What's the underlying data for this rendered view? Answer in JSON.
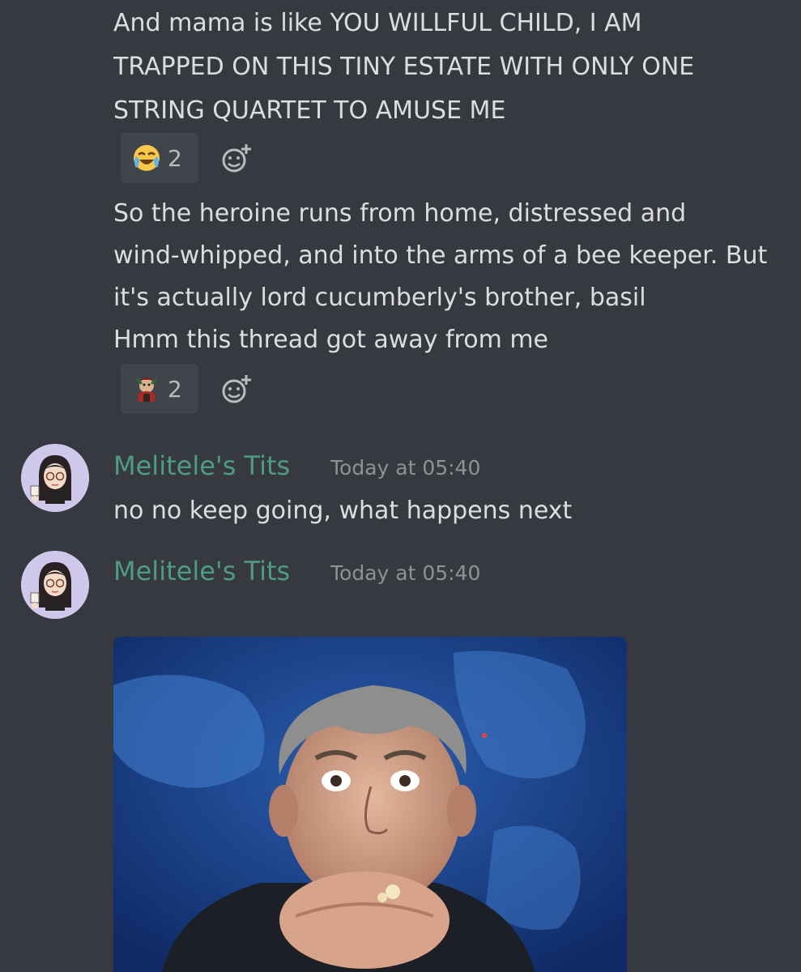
{
  "messages": {
    "first_block": {
      "lines": [
        "And mama is like YOU WILLFUL CHILD, I AM",
        "TRAPPED ON THIS TINY ESTATE WITH ONLY ONE",
        "STRING QUARTET TO AMUSE ME"
      ],
      "reaction": {
        "emoji": "joy-emoji",
        "count": "2"
      }
    },
    "second_block": {
      "lines": [
        "So the heroine runs from home, distressed and",
        "wind-whipped, and into the arms of a bee keeper. But",
        "it's actually lord cucumberly's brother, basil",
        "Hmm this thread got away from me"
      ],
      "reaction": {
        "emoji": "custom-character-emoji",
        "count": "2"
      }
    },
    "reply_1": {
      "username": "Melitele's Tits",
      "timestamp": "Today at 05:40",
      "text": "no no keep going, what happens next"
    },
    "reply_2": {
      "username": "Melitele's Tits",
      "timestamp": "Today at 05:40",
      "attachment": "gif-man-eating-popcorn"
    }
  },
  "colors": {
    "background": "#36393f",
    "text": "#dcddde",
    "username": "#4e9c84",
    "timestamp": "#8e9297",
    "reaction_bg": "#40444b"
  }
}
